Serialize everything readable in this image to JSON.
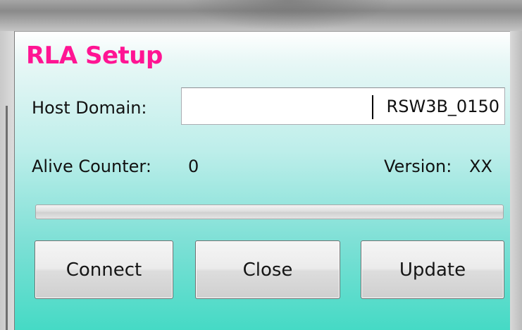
{
  "dialog": {
    "title": "RLA Setup",
    "host_domain": {
      "label": "Host Domain:",
      "value": "RSW3B_0150"
    },
    "alive_counter": {
      "label": "Alive Counter:",
      "value": "0"
    },
    "version": {
      "label": "Version:",
      "value": "XX"
    },
    "progress": {
      "value_percent": 0
    },
    "buttons": {
      "connect": "Connect",
      "close": "Close",
      "update": "Update"
    }
  },
  "colors": {
    "title": "#ff1493",
    "background_top": "#ffffff",
    "background_bottom": "#45dac5"
  }
}
